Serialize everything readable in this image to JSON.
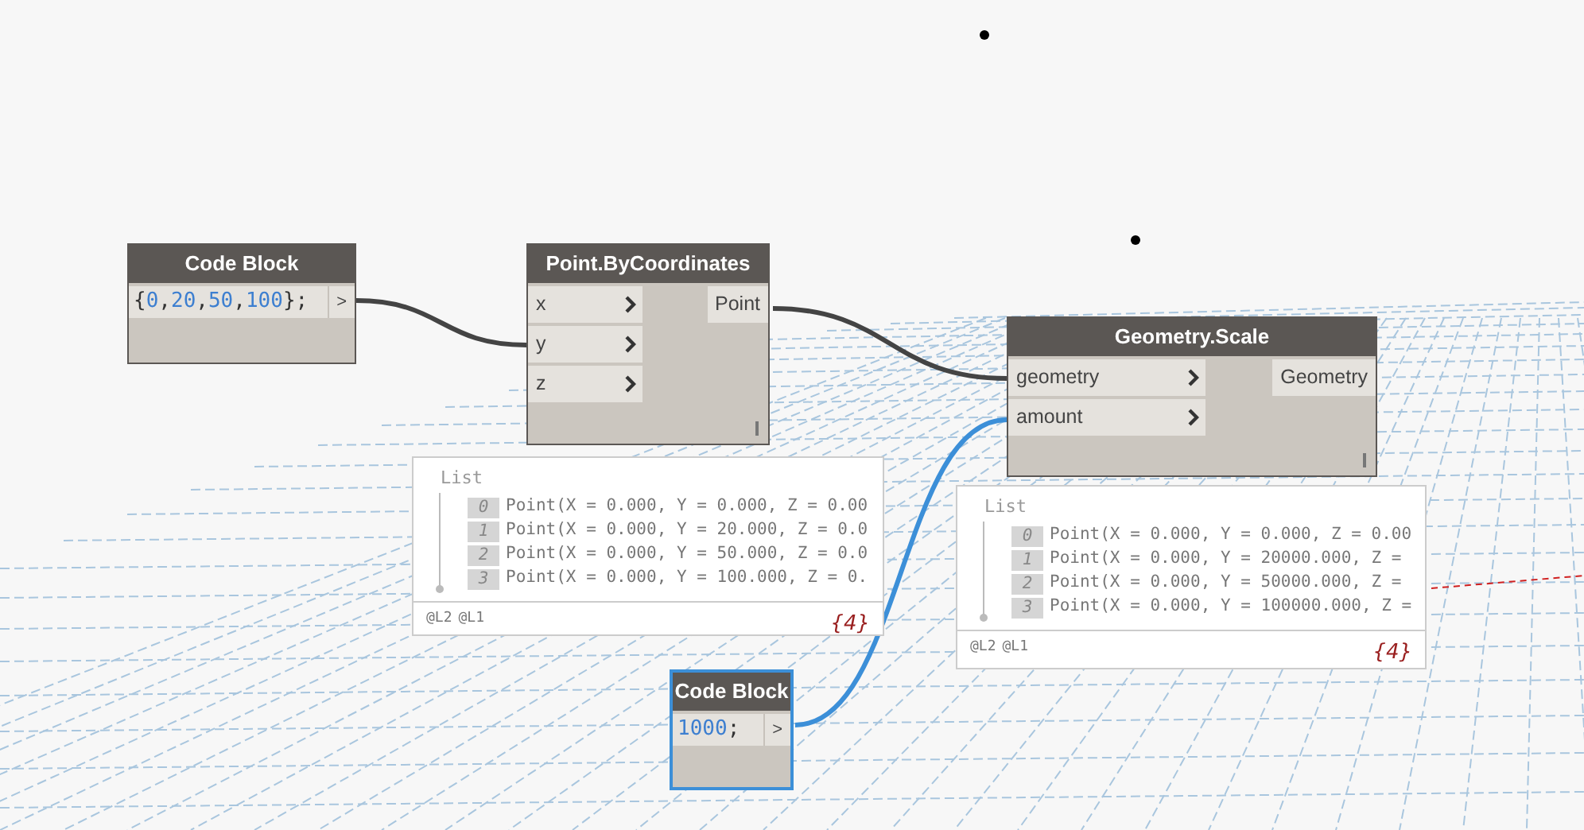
{
  "nodes": [
    {
      "kind": "code",
      "title": "Code Block",
      "code": "{0,20,50,100};",
      "output": ">",
      "selected": false
    },
    {
      "kind": "function",
      "title": "Point.ByCoordinates",
      "inputs": [
        "x",
        "y",
        "z"
      ],
      "outputs": [
        "Point"
      ],
      "selected": false,
      "preview": {
        "title": "List",
        "items": [
          {
            "index": "0",
            "text": "Point(X = 0.000, Y = 0.000, Z = 0.00"
          },
          {
            "index": "1",
            "text": "Point(X = 0.000, Y = 20.000, Z = 0.0"
          },
          {
            "index": "2",
            "text": "Point(X = 0.000, Y = 50.000, Z = 0.0"
          },
          {
            "index": "3",
            "text": "Point(X = 0.000, Y = 100.000, Z = 0."
          }
        ],
        "levels": [
          "@L2",
          "@L1"
        ],
        "count": "{4}"
      }
    },
    {
      "kind": "function",
      "title": "Geometry.Scale",
      "inputs": [
        "geometry",
        "amount"
      ],
      "outputs": [
        "Geometry"
      ],
      "selected": false,
      "preview": {
        "title": "List",
        "items": [
          {
            "index": "0",
            "text": "Point(X = 0.000, Y = 0.000, Z = 0.00"
          },
          {
            "index": "1",
            "text": "Point(X = 0.000, Y = 20000.000, Z ="
          },
          {
            "index": "2",
            "text": "Point(X = 0.000, Y = 50000.000, Z ="
          },
          {
            "index": "3",
            "text": "Point(X = 0.000, Y = 100000.000, Z ="
          }
        ],
        "levels": [
          "@L2",
          "@L1"
        ],
        "count": "{4}"
      }
    },
    {
      "kind": "code",
      "title": "Code Block",
      "code": "1000;",
      "output": ">",
      "selected": true
    }
  ]
}
